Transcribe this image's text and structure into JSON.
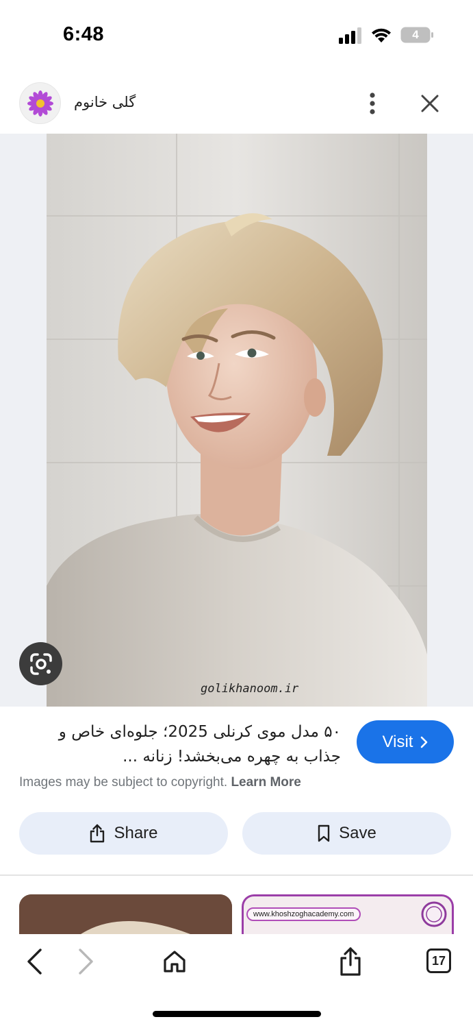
{
  "status_bar": {
    "time": "6:48",
    "battery": "4",
    "icons": [
      "signal-icon",
      "wifi-icon",
      "battery-icon"
    ]
  },
  "header": {
    "site_name": "گلی خانوم",
    "avatar_icon": "flower-logo-icon",
    "more_icon": "more-vert-icon",
    "close_icon": "close-icon"
  },
  "image": {
    "watermark": "golikhanoom.ir",
    "lens_icon": "google-lens-icon"
  },
  "info": {
    "title_line1": "۵۰ مدل موی کرنلی 2025؛ جلوه‌ای خاص و",
    "title_line2": "جذاب به چهره می‌بخشد! زنانه ...",
    "visit_label": "Visit",
    "copyright_text": "Images may be subject to copyright.",
    "learn_more": "Learn More"
  },
  "actions": {
    "share_label": "Share",
    "save_label": "Save"
  },
  "related": {
    "thumb2_url": "www.khoshzoghacademy.com"
  },
  "toolbar": {
    "tabs_count": "17",
    "icons": [
      "back-icon",
      "forward-icon",
      "home-icon",
      "share-icon",
      "tabs-icon"
    ]
  },
  "colors": {
    "accent": "#1a73e8",
    "chip_bg": "#e8eef9",
    "muted_text": "#70757a"
  }
}
